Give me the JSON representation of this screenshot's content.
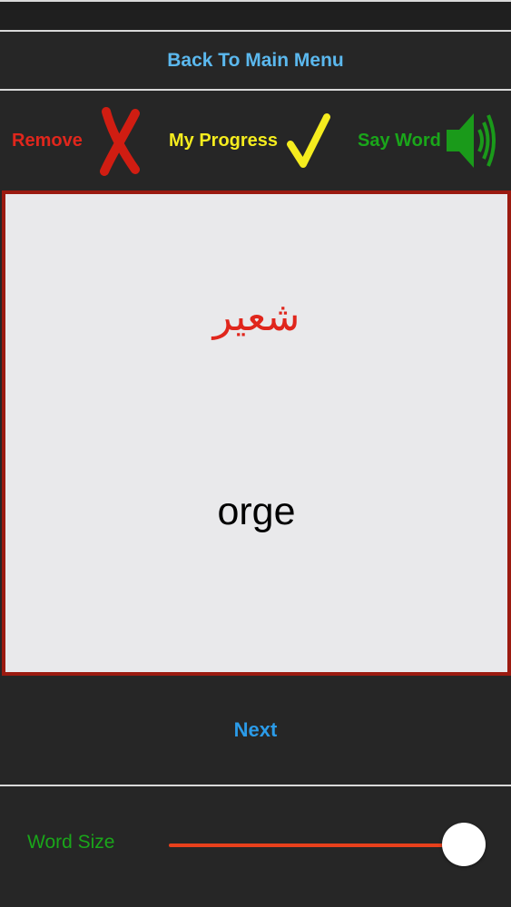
{
  "header": {
    "back_label": "Back To Main Menu"
  },
  "toolbar": {
    "remove_label": "Remove",
    "progress_label": "My Progress",
    "say_word_label": "Say Word",
    "remove_icon": "x-mark-icon",
    "progress_icon": "checkmark-icon",
    "say_word_icon": "speaker-icon"
  },
  "card": {
    "foreign_word": "شعير",
    "native_word": "orge"
  },
  "footer": {
    "next_label": "Next"
  },
  "word_size": {
    "label": "Word Size",
    "value_fraction": 1.0
  },
  "colors": {
    "background": "#262626",
    "remove": "#e0261c",
    "progress": "#f5ec1e",
    "say_word": "#1aa61a",
    "link": "#5bb8ee",
    "card_border": "#9b1a10"
  }
}
